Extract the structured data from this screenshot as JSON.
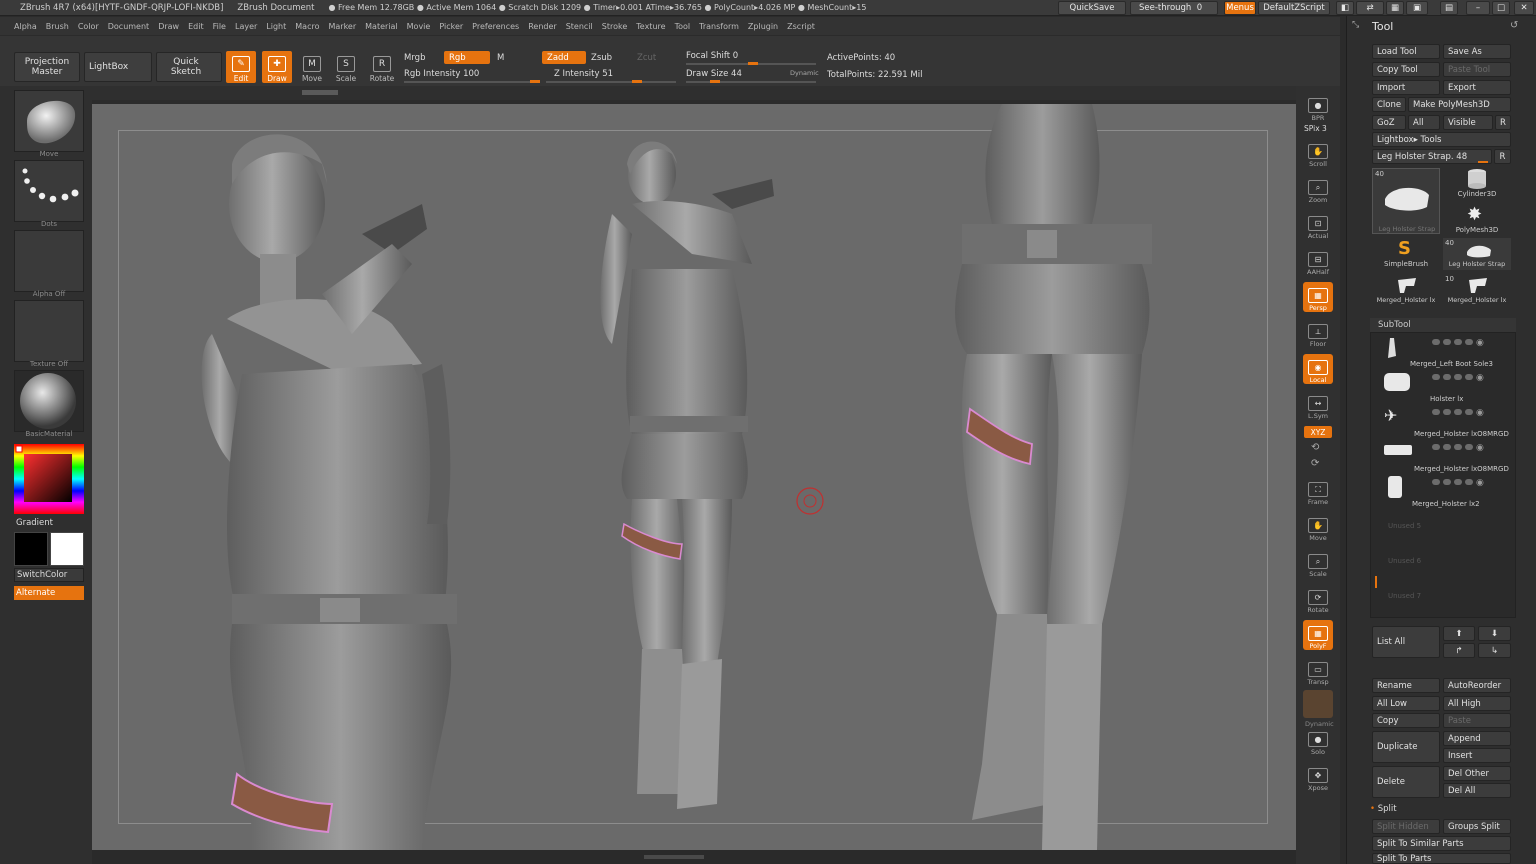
{
  "title_bar": {
    "app": "ZBrush 4R7 (x64)[HYTF-GNDF-QRJP-LOFI-NKDB]",
    "document": "ZBrush Document",
    "stats": "● Free Mem 12.78GB ● Active Mem 1064 ● Scratch Disk 1209 ● Timer▸0.001 ATime▸36.765 ● PolyCount▸4.026 MP ● MeshCount▸15",
    "quicksave": "QuickSave",
    "see_through": "See-through",
    "see_through_value": "0",
    "menus": "Menus",
    "script": "DefaultZScript"
  },
  "menu_bar": [
    "Alpha",
    "Brush",
    "Color",
    "Document",
    "Draw",
    "Edit",
    "File",
    "Layer",
    "Light",
    "Macro",
    "Marker",
    "Material",
    "Movie",
    "Picker",
    "Preferences",
    "Render",
    "Stencil",
    "Stroke",
    "Texture",
    "Tool",
    "Transform",
    "Zplugin",
    "Zscript"
  ],
  "toolbar": {
    "projection_master": "Projection Master",
    "lightbox": "LightBox",
    "quick_sketch": "Quick Sketch",
    "edit": "Edit",
    "draw": "Draw",
    "move": "Move",
    "scale": "Scale",
    "rotate": "Rotate",
    "mrgb": "Mrgb",
    "rgb": "Rgb",
    "m": "M",
    "rgb_intensity": "Rgb Intensity 100",
    "zadd": "Zadd",
    "zsub": "Zsub",
    "zcut": "Zcut",
    "z_intensity": "Z Intensity 51",
    "focal_shift": "Focal Shift 0",
    "draw_size": "Draw Size 44",
    "dynamic": "Dynamic",
    "active_points": "ActivePoints: 40",
    "total_points": "TotalPoints: 22.591 Mil"
  },
  "left_shelf": {
    "brush": "Move",
    "stroke": "Dots",
    "alpha": "Alpha Off",
    "texture": "Texture Off",
    "material": "BasicMaterial",
    "gradient": "Gradient",
    "switch_color": "SwitchColor",
    "alternate": "Alternate"
  },
  "right_shelf": [
    {
      "name": "BPR",
      "on": false
    },
    {
      "name": "Scroll",
      "on": false
    },
    {
      "name": "Zoom",
      "on": false
    },
    {
      "name": "Actual",
      "on": false
    },
    {
      "name": "AAHalf",
      "on": false
    },
    {
      "name": "Persp",
      "on": true
    },
    {
      "name": "Floor",
      "on": false
    },
    {
      "name": "Local",
      "on": true
    },
    {
      "name": "L.Sym",
      "on": false
    },
    {
      "name": "Frame",
      "on": false
    },
    {
      "name": "Move",
      "on": false
    },
    {
      "name": "Scale",
      "on": false
    },
    {
      "name": "Rotate",
      "on": false
    },
    {
      "name": "PolyF",
      "on": true
    },
    {
      "name": "Transp",
      "on": false
    },
    {
      "name": "Solo",
      "on": false
    },
    {
      "name": "Xpose",
      "on": false
    }
  ],
  "right_shelf_extra": {
    "spix": "SPix 3",
    "xyz": "XYZ",
    "dynamic": "Dynamic"
  },
  "tool_palette": {
    "header": "Tool",
    "load_tool": "Load Tool",
    "save_as": "Save As",
    "copy_tool": "Copy Tool",
    "paste_tool": "Paste Tool",
    "import": "Import",
    "export": "Export",
    "clone": "Clone",
    "make_polymesh": "Make PolyMesh3D",
    "goz": "GoZ",
    "all": "All",
    "visible": "Visible",
    "r": "R",
    "lightbox_tools": "Lightbox▸ Tools",
    "current_tool": "Leg Holster Strap. 48",
    "tool_thumbs": [
      {
        "name": "Leg Holster Strap",
        "count": "40"
      },
      {
        "name": "Cylinder3D",
        "count": ""
      },
      {
        "name": "PolyMesh3D",
        "count": ""
      },
      {
        "name": "SimpleBrush",
        "count": ""
      },
      {
        "name": "Leg Holster Strap",
        "count": "40"
      },
      {
        "name": "Merged_Holster lx",
        "count": ""
      },
      {
        "name": "Merged_Holster lx",
        "count": "10"
      }
    ]
  },
  "subtool": {
    "header": "SubTool",
    "items": [
      "Merged_Left Boot Sole3",
      "Holster lx",
      "Merged_Holster lxO8MRGD",
      "Merged_Holster lxO8MRGD",
      "Merged_Holster lx2"
    ],
    "unused": [
      "Unused 5",
      "Unused 6",
      "Unused 7"
    ],
    "list_all": "List All",
    "rename": "Rename",
    "autoreorder": "AutoReorder",
    "all_low": "All Low",
    "all_high": "All High",
    "copy": "Copy",
    "paste": "Paste",
    "duplicate": "Duplicate",
    "append": "Append",
    "insert": "Insert",
    "delete": "Delete",
    "del_other": "Del Other",
    "del_all": "Del All",
    "split": "Split",
    "split_hidden": "Split Hidden",
    "groups_split": "Groups Split",
    "split_similar": "Split To Similar Parts",
    "split_parts": "Split To Parts"
  },
  "colors": {
    "accent": "#e6730f",
    "canvas": "#6a6a6a",
    "strap": "#8a5a44",
    "strap_edge": "#d98ad0"
  }
}
